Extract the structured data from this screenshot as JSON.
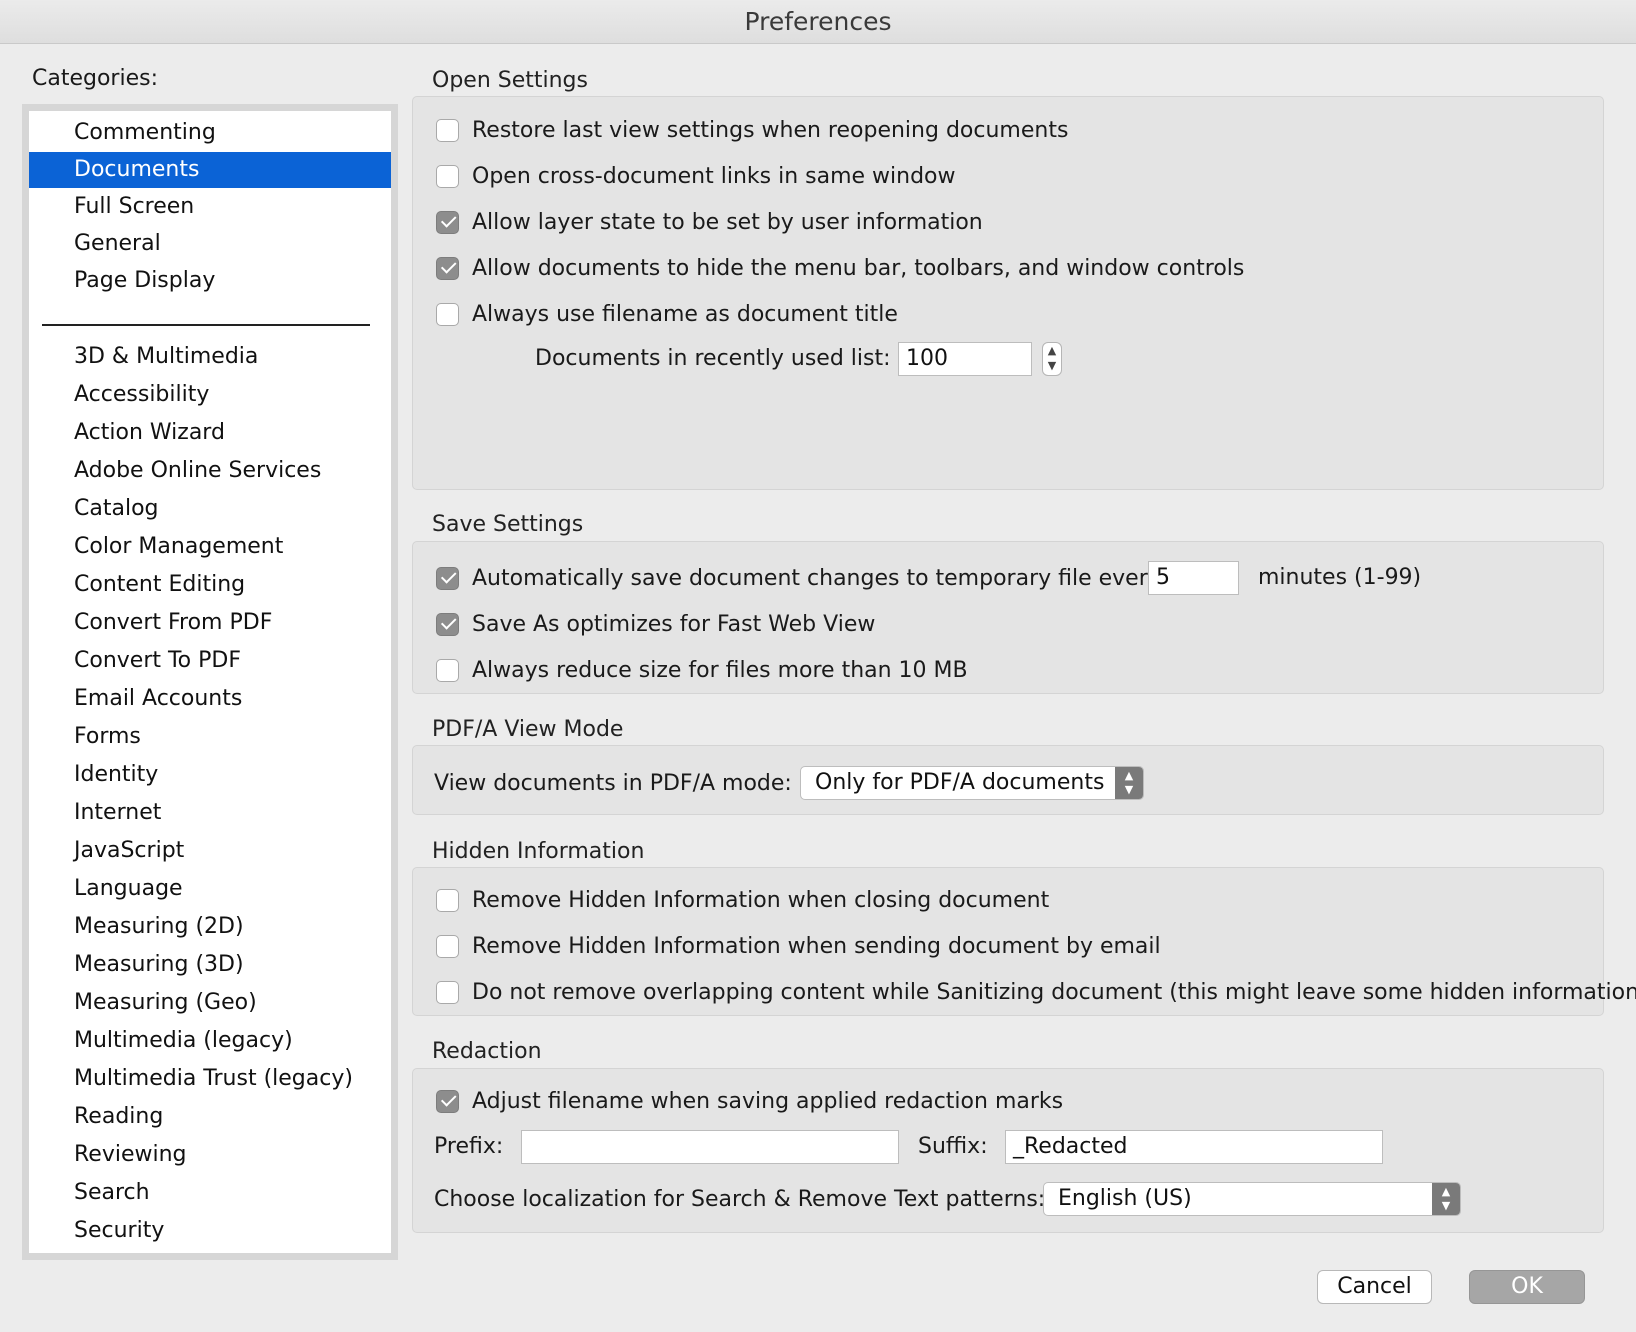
{
  "window": {
    "title": "Preferences"
  },
  "categories": {
    "label": "Categories:",
    "top_items": [
      "Commenting",
      "Documents",
      "Full Screen",
      "General",
      "Page Display"
    ],
    "selected": "Documents",
    "items": [
      "3D & Multimedia",
      "Accessibility",
      "Action Wizard",
      "Adobe Online Services",
      "Catalog",
      "Color Management",
      "Content Editing",
      "Convert From PDF",
      "Convert To PDF",
      "Email Accounts",
      "Forms",
      "Identity",
      "Internet",
      "JavaScript",
      "Language",
      "Measuring (2D)",
      "Measuring (3D)",
      "Measuring (Geo)",
      "Multimedia (legacy)",
      "Multimedia Trust (legacy)",
      "Reading",
      "Reviewing",
      "Search",
      "Security"
    ]
  },
  "open_settings": {
    "title": "Open Settings",
    "options": [
      {
        "label": "Restore last view settings when reopening documents",
        "checked": false
      },
      {
        "label": "Open cross-document links in same window",
        "checked": false
      },
      {
        "label": "Allow layer state to be set by user information",
        "checked": true
      },
      {
        "label": "Allow documents to hide the menu bar, toolbars, and window controls",
        "checked": true
      },
      {
        "label": "Always use filename as document title",
        "checked": false
      }
    ],
    "recent_list_label": "Documents in recently used list:",
    "recent_list_value": "100"
  },
  "save_settings": {
    "title": "Save Settings",
    "autosave_label": "Automatically save document changes to temporary file every:",
    "autosave_checked": true,
    "autosave_value": "5",
    "autosave_unit": "minutes (1-99)",
    "fast_web_label": "Save As optimizes for Fast Web View",
    "fast_web_checked": true,
    "reduce_size_label": "Always reduce size for files more than 10 MB",
    "reduce_size_checked": false
  },
  "pdfa": {
    "title": "PDF/A View Mode",
    "label": "View documents in PDF/A mode:",
    "selected": "Only for PDF/A documents"
  },
  "hidden_info": {
    "title": "Hidden Information",
    "options": [
      {
        "label": "Remove Hidden Information when closing document",
        "checked": false
      },
      {
        "label": "Remove Hidden Information when sending document by email",
        "checked": false
      },
      {
        "label": "Do not remove overlapping content while Sanitizing document (this might leave some hidden information)",
        "checked": false
      }
    ]
  },
  "redaction": {
    "title": "Redaction",
    "adjust_label": "Adjust filename when saving applied redaction marks",
    "adjust_checked": true,
    "prefix_label": "Prefix:",
    "prefix_value": "",
    "suffix_label": "Suffix:",
    "suffix_value": "_Redacted",
    "localization_label": "Choose localization for Search & Remove Text patterns:",
    "localization_value": "English (US)"
  },
  "buttons": {
    "cancel": "Cancel",
    "ok": "OK"
  }
}
